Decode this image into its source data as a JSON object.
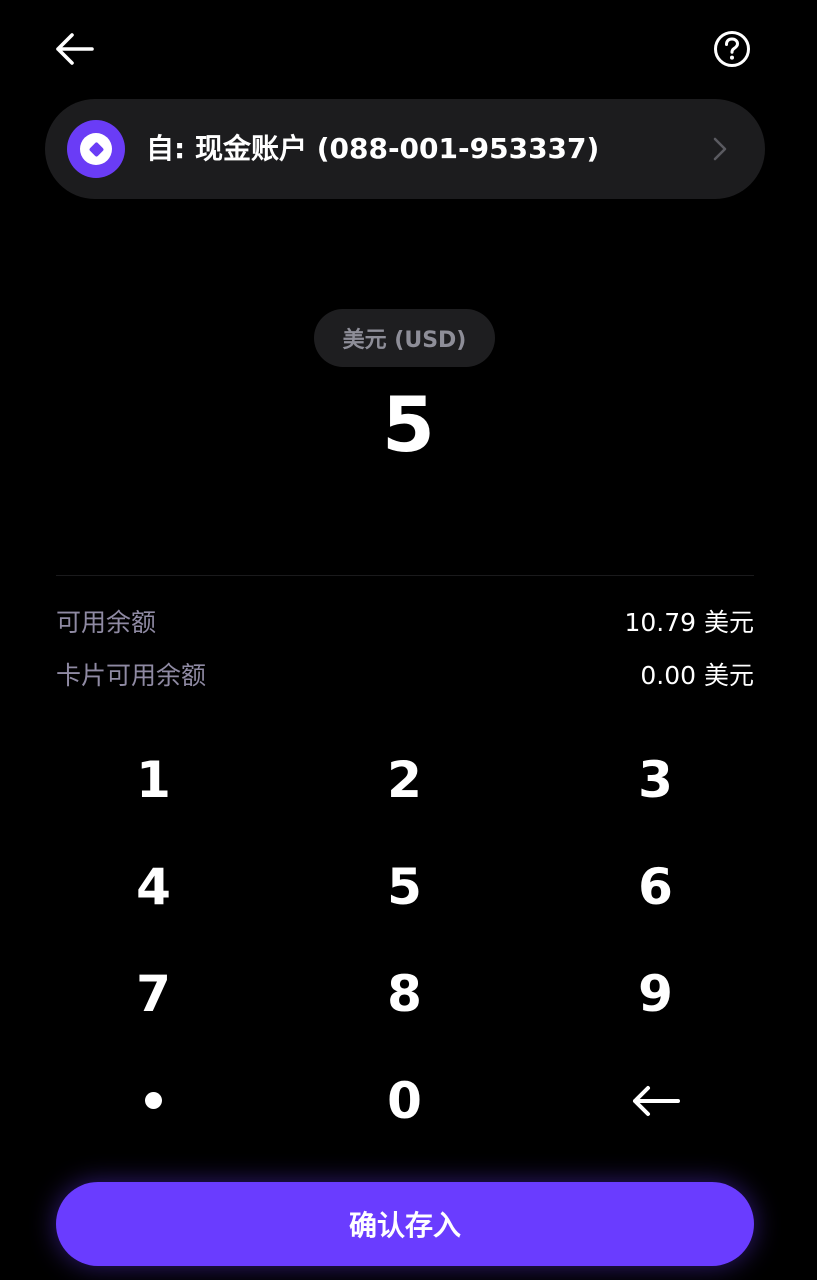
{
  "header": {
    "back_icon": "arrow-left-icon",
    "help_icon": "question-circle-icon"
  },
  "account": {
    "label": "自: 现金账户 (088-001-953337)",
    "logo_icon": "diamond-logo-icon",
    "chevron_icon": "chevron-right-icon"
  },
  "currency": {
    "label": "美元 (USD)"
  },
  "amount": {
    "value": "5"
  },
  "balances": [
    {
      "label": "可用余额",
      "value": "10.79 美元"
    },
    {
      "label": "卡片可用余额",
      "value": "0.00 美元"
    }
  ],
  "keypad": {
    "keys": [
      "1",
      "2",
      "3",
      "4",
      "5",
      "6",
      "7",
      "8",
      "9"
    ],
    "dot_icon": "decimal-point-icon",
    "zero": "0",
    "backspace_icon": "backspace-arrow-icon"
  },
  "confirm": {
    "label": "确认存入"
  },
  "colors": {
    "accent": "#6a3cff",
    "background": "#000000",
    "card": "#1c1c1e",
    "muted_text": "#8f8aa3"
  }
}
